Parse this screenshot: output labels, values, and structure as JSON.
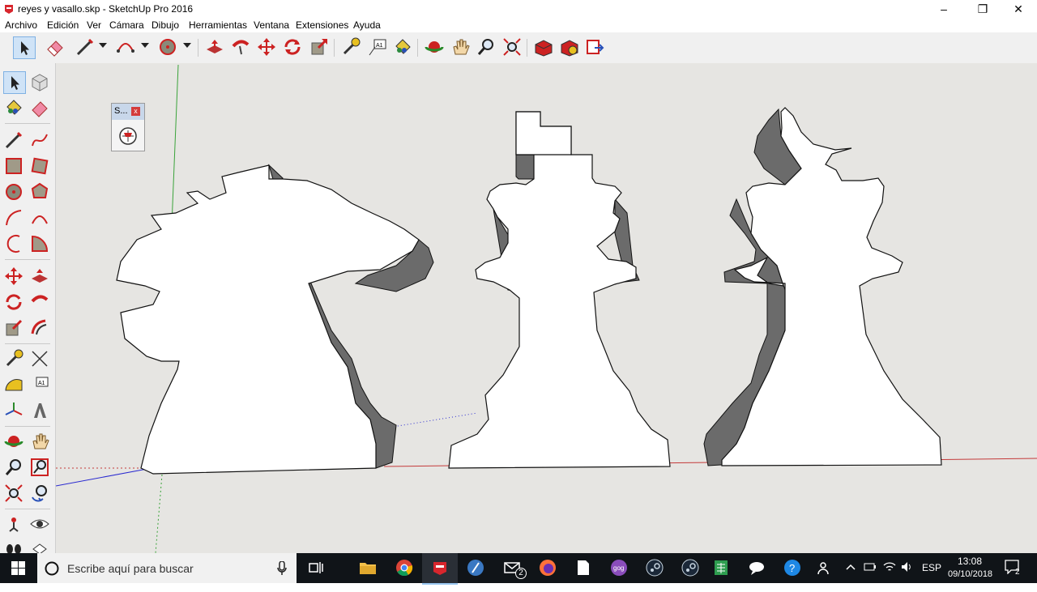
{
  "window": {
    "title": "reyes y vasallo.skp - SketchUp Pro 2016",
    "minimize_glyph": "–",
    "restore_glyph": "❐",
    "close_glyph": "✕"
  },
  "menu": [
    {
      "label": "Archivo"
    },
    {
      "label": "Edición"
    },
    {
      "label": "Ver"
    },
    {
      "label": "Cámara"
    },
    {
      "label": "Dibujo"
    },
    {
      "label": "Herramientas"
    },
    {
      "label": "Ventana"
    },
    {
      "label": "Extensiones"
    },
    {
      "label": "Ayuda"
    }
  ],
  "toolbar_icons": [
    "select-icon",
    "eraser-icon",
    "line-icon",
    "arc-icon",
    "circle-icon",
    "push-pull-icon",
    "follow-me-icon",
    "move-icon",
    "rotate-icon",
    "scale-icon",
    "tape-measure-icon",
    "text-icon",
    "paint-bucket-icon",
    "orbit-icon",
    "pan-icon",
    "zoom-icon",
    "zoom-extents-icon",
    "warehouse-icon",
    "extension-warehouse-icon",
    "send-to-layout-icon"
  ],
  "stamp_panel": {
    "title": "S...",
    "close": "x"
  },
  "taskbar": {
    "search_placeholder": "Escribe aquí para buscar",
    "mail_badge": "2",
    "language": "ESP",
    "time": "13:08",
    "date": "09/10/2018",
    "notification_badge": "2"
  },
  "colors": {
    "viewport": "#e6e5e2",
    "axis_red": "#c43a3a",
    "axis_green": "#3aa33a",
    "axis_blue": "#2a2ad0",
    "taskbar": "#101418",
    "selection_blue": "#cfe3f7"
  }
}
